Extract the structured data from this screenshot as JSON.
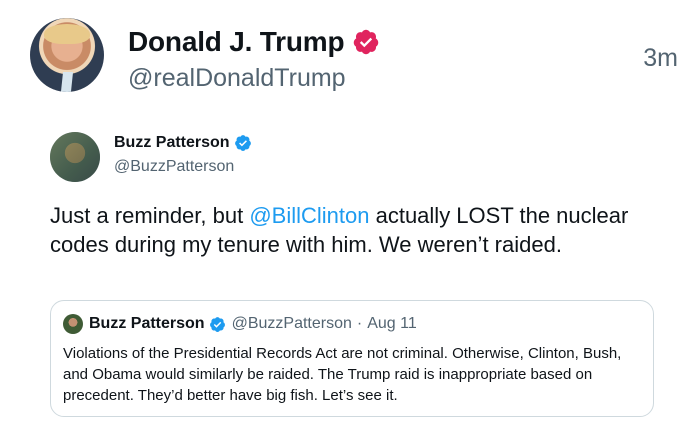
{
  "post": {
    "author_name": "Donald J. Trump",
    "author_handle": "@realDonaldTrump",
    "timestamp": "3m",
    "verified_icon": "verified-badge-icon",
    "badge_color": "#e0245e"
  },
  "quoted_tweet": {
    "author_name": "Buzz Patterson",
    "author_handle": "@BuzzPatterson",
    "verified_icon": "verified-badge-icon",
    "badge_color": "#1d9bf0",
    "body_before": "Just a reminder, but ",
    "mention": "@BillClinton",
    "body_after": " actually LOST the nuclear codes during my tenure with him. We weren’t raided."
  },
  "nested_quote": {
    "author_name": "Buzz Patterson",
    "author_handle": "@BuzzPatterson",
    "separator": "·",
    "date": "Aug 11",
    "body": "Violations of the Presidential Records Act are not criminal. Otherwise, Clinton, Bush, and Obama would similarly be raided. The Trump raid is inappropriate based on precedent. They’d better have big fish. Let’s see it."
  }
}
